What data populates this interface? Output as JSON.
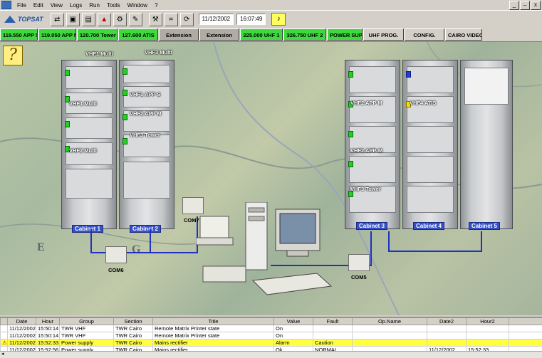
{
  "menu": {
    "items": [
      "File",
      "Edit",
      "View",
      "Logs",
      "Run",
      "Tools",
      "Window",
      "?"
    ],
    "window_controls": [
      "_",
      "̶",
      "x"
    ]
  },
  "toolbar": {
    "logo_text": "TOPSAT",
    "date": "11/12/2002",
    "time": "16:07:49"
  },
  "buttons": [
    {
      "label": "119.550 APP S",
      "state": "green"
    },
    {
      "label": "119.050 APP M",
      "state": "green"
    },
    {
      "label": "120.700 Tower",
      "state": "green"
    },
    {
      "label": "127.600 ATIS",
      "state": "green"
    },
    {
      "label": "Extension",
      "state": "disabled"
    },
    {
      "label": "Extension",
      "state": "disabled"
    },
    {
      "label": "225.000 UHF 1",
      "state": "green"
    },
    {
      "label": "326.750 UHF 2",
      "state": "green"
    },
    {
      "label": "POWER SUP.",
      "state": "green"
    },
    {
      "label": "UHF PROG.",
      "state": "plain"
    },
    {
      "label": "CONFIG.",
      "state": "plain"
    },
    {
      "label": "CAIRO VIDEO",
      "state": "plain"
    }
  ],
  "map": {
    "cabinets": [
      {
        "label": "Cabinet 1"
      },
      {
        "label": "Cabinet 2"
      },
      {
        "label": "Cabinet 3"
      },
      {
        "label": "Cabinet 4"
      },
      {
        "label": "Cabinet 5"
      }
    ],
    "unit_labels": {
      "vhf1_multi_top": "VHF1 Multi",
      "vhf3_multi_top": "VHF3 Multi",
      "vhf1_multi": "VHF1 Multi",
      "vhf1_app_s": "VHF1 APP S",
      "vhf2_app_m": "VHF2 APP M",
      "vhf3_tower": "VHF3 Tower",
      "vhf2_multi": "VHF2 Multi",
      "vhf2_app_m2": "VHF2 APP M",
      "vhf4_atis": "VHF4 ATIS",
      "vhf2_app_m3": "VHF2 APP-M",
      "vhf3_tower2": "VHF3 Tower"
    },
    "com_labels": [
      "COM7",
      "COM6",
      "COM5"
    ],
    "place_letters": [
      "E",
      "G"
    ]
  },
  "log": {
    "columns": [
      "Date",
      "Hour",
      "Group",
      "Section",
      "Title",
      "Value",
      "Fault",
      "Op.Name",
      "Date2",
      "Hour2"
    ],
    "rows": [
      {
        "marker": "",
        "date": "11/12/2002",
        "hour": "15:50:14",
        "group": "TWR VHF",
        "section": "TWR Cairo",
        "title": "Remote Matrix Printer state",
        "value": "On",
        "fault": "",
        "op": "",
        "date2": "",
        "hour2": "",
        "alarm": false
      },
      {
        "marker": "",
        "date": "11/12/2002",
        "hour": "15:50:14",
        "group": "TWR VHF",
        "section": "TWR Cairo",
        "title": "Remote Matrix Printer state",
        "value": "On",
        "fault": "",
        "op": "",
        "date2": "",
        "hour2": "",
        "alarm": false
      },
      {
        "marker": "⚠",
        "date": "11/12/2002",
        "hour": "15:52:33",
        "group": "Power supply",
        "section": "TWR Cairo",
        "title": "Mains rectifier",
        "value": "Alarm",
        "fault": "Caution",
        "op": "",
        "date2": "",
        "hour2": "",
        "alarm": true
      },
      {
        "marker": "",
        "date": "11/12/2002",
        "hour": "15:52:56",
        "group": "Power supply",
        "section": "TWR Cairo",
        "title": "Mains rectifier",
        "value": "Ok",
        "fault": "NORMAL",
        "op": "",
        "date2": "11/12/2002",
        "hour2": "15:52:33",
        "alarm": false
      }
    ]
  },
  "colors": {
    "green_button": "#3ed93e",
    "alarm_row": "#ffff40",
    "cabinet_label": "#3550c8",
    "link_line": "#2030c0"
  }
}
